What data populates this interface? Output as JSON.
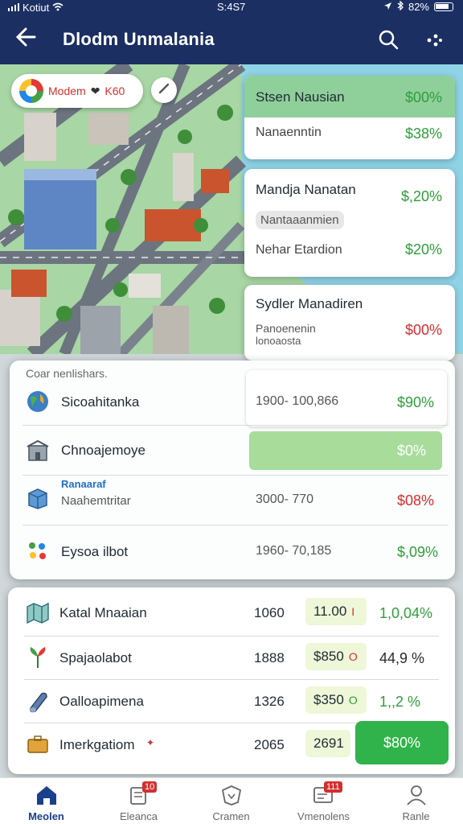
{
  "status_bar": {
    "carrier": "Kotiut",
    "time": "S:4S7",
    "battery": "82%"
  },
  "app_bar": {
    "title": "Dlodm Unmalania"
  },
  "map_chip": {
    "label": "Modem",
    "value": "K60"
  },
  "cards": [
    {
      "title": "Stsen Nausian",
      "title_value": "$00%",
      "rows": [
        {
          "label": "Nanaenntin",
          "value": "$38%"
        }
      ]
    },
    {
      "title": "Mandja Nanatan",
      "title_value": "$,20%",
      "pill": "Nantaaanmien",
      "rows": [
        {
          "label": "Nehar Etardion",
          "value": "$20%"
        }
      ]
    },
    {
      "title": "Sydler Manadiren",
      "subtitle_line1": "Panoenenin",
      "subtitle_line2": "lonoaosta",
      "subtitle_value": "$00%"
    }
  ],
  "panel1": {
    "header": "Coar nenlishars.",
    "rows": [
      {
        "icon": "globe-icon",
        "name": "Sicoahitanka",
        "range": "1900- 100,866",
        "pct": "$90%"
      },
      {
        "icon": "building-icon",
        "name": "Chnoajemoye",
        "pct": "$0%"
      },
      {
        "icon": "box-icon",
        "subtitle": "Ranaaraf",
        "name": "Naahemtritar",
        "range": "3000- 770",
        "pct": "$08%"
      },
      {
        "icon": "chart-dots-icon",
        "name": "Eysoa ilbot",
        "range": "1960- 70,185",
        "pct": "$,09%"
      }
    ],
    "bar_fill": 1.0
  },
  "panel2": {
    "rows": [
      {
        "icon": "map-icon",
        "name": "Katal Mnaaian",
        "num": "1060",
        "tag": "11.00",
        "tag_mark": "I",
        "pct": "1,0,04%"
      },
      {
        "icon": "plant-icon",
        "name": "Spajaolabot",
        "num": "1888",
        "tag": "$850",
        "tag_mark": "O",
        "pct": "44,9 %"
      },
      {
        "icon": "cylinder-icon",
        "name": "Oalloapimena",
        "num": "1326",
        "tag": "$350",
        "tag_mark": "O",
        "pct": "1,,2 %"
      },
      {
        "icon": "briefcase-icon",
        "name": "Imerkgatiom",
        "num": "2065",
        "tag": "2691",
        "tag_mark": "",
        "pct": ""
      }
    ],
    "cta_label": "$80%"
  },
  "bottom_nav": [
    {
      "icon": "home-icon",
      "label": "Meolen",
      "active": true
    },
    {
      "icon": "clipboard-icon",
      "label": "Eleanca",
      "badge": "10"
    },
    {
      "icon": "shield-icon",
      "label": "Cramen"
    },
    {
      "icon": "calendar-icon",
      "label": "Vmenolens",
      "badge": "111"
    },
    {
      "icon": "profile-icon",
      "label": "Ranle"
    }
  ],
  "colors": {
    "header": "#1b2f63",
    "accent_green": "#2e9e3a",
    "accent_red": "#d32f2f",
    "cta_green": "#2fb34a"
  }
}
